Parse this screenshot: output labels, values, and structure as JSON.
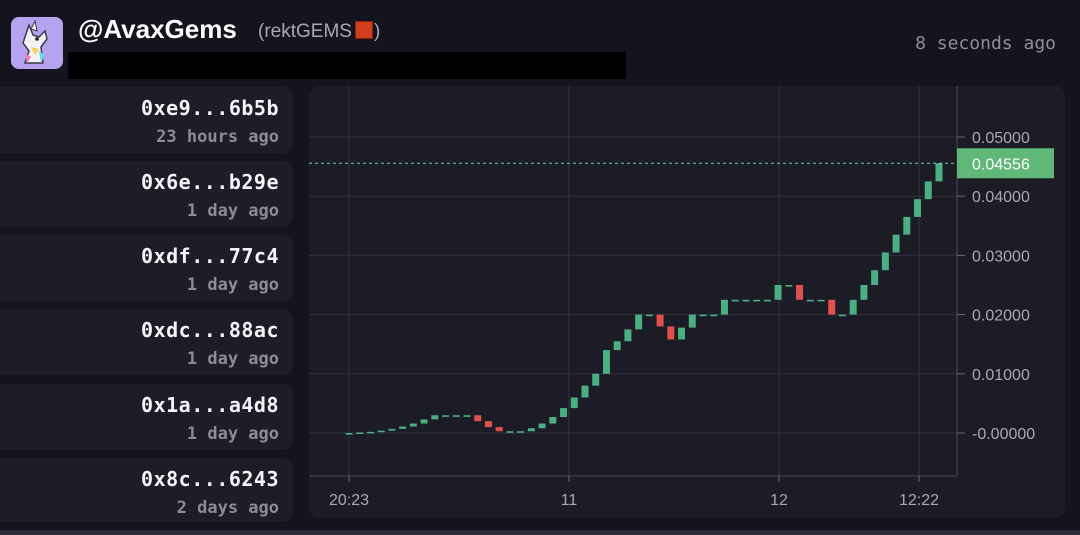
{
  "header": {
    "handle": "@AvaxGems",
    "subtitle": "(rektGEMS",
    "subtitle_close": ")",
    "updated": "8 seconds ago"
  },
  "wallets": [
    {
      "address": "0xe9...6b5b",
      "time": "23 hours ago"
    },
    {
      "address": "0x6e...b29e",
      "time": "1 day ago"
    },
    {
      "address": "0xdf...77c4",
      "time": "1 day ago"
    },
    {
      "address": "0xdc...88ac",
      "time": "1 day ago"
    },
    {
      "address": "0x1a...a4d8",
      "time": "1 day ago"
    },
    {
      "address": "0x8c...6243",
      "time": "2 days ago"
    }
  ],
  "colors": {
    "up": "#4caf82",
    "down": "#e0504c",
    "price_tag": "#5fb878",
    "grid": "#33333f"
  },
  "chart_data": {
    "type": "candlestick",
    "x_ticks": [
      "20:23",
      "11",
      "12",
      "12:22"
    ],
    "y_ticks": [
      "0.05000",
      "0.04000",
      "0.03000",
      "0.02000",
      "0.01000",
      "-0.00000"
    ],
    "ylim": [
      -0.005,
      0.058
    ],
    "last_price": "0.04556",
    "candles": [
      {
        "o": 0.0,
        "c": 0.0
      },
      {
        "o": 0.0,
        "c": 0.0001
      },
      {
        "o": 0.0001,
        "c": 0.0002
      },
      {
        "o": 0.0002,
        "c": 0.0004
      },
      {
        "o": 0.0004,
        "c": 0.0007
      },
      {
        "o": 0.0007,
        "c": 0.0011
      },
      {
        "o": 0.0011,
        "c": 0.0016
      },
      {
        "o": 0.0016,
        "c": 0.0023
      },
      {
        "o": 0.0023,
        "c": 0.003
      },
      {
        "o": 0.003,
        "c": 0.003
      },
      {
        "o": 0.003,
        "c": 0.003
      },
      {
        "o": 0.003,
        "c": 0.003
      },
      {
        "o": 0.003,
        "c": 0.002
      },
      {
        "o": 0.002,
        "c": 0.001
      },
      {
        "o": 0.001,
        "c": 0.0003
      },
      {
        "o": 0.0003,
        "c": 0.0003
      },
      {
        "o": 0.0003,
        "c": 0.0003
      },
      {
        "o": 0.0003,
        "c": 0.0008
      },
      {
        "o": 0.0008,
        "c": 0.0016
      },
      {
        "o": 0.0016,
        "c": 0.0027
      },
      {
        "o": 0.0027,
        "c": 0.0042
      },
      {
        "o": 0.0042,
        "c": 0.006
      },
      {
        "o": 0.006,
        "c": 0.008
      },
      {
        "o": 0.008,
        "c": 0.01
      },
      {
        "o": 0.01,
        "c": 0.014
      },
      {
        "o": 0.014,
        "c": 0.0155
      },
      {
        "o": 0.0155,
        "c": 0.0175
      },
      {
        "o": 0.0175,
        "c": 0.02
      },
      {
        "o": 0.02,
        "c": 0.02
      },
      {
        "o": 0.02,
        "c": 0.018
      },
      {
        "o": 0.018,
        "c": 0.0158
      },
      {
        "o": 0.0158,
        "c": 0.0178
      },
      {
        "o": 0.0178,
        "c": 0.02
      },
      {
        "o": 0.02,
        "c": 0.02
      },
      {
        "o": 0.02,
        "c": 0.02
      },
      {
        "o": 0.02,
        "c": 0.0225
      },
      {
        "o": 0.0225,
        "c": 0.0225
      },
      {
        "o": 0.0225,
        "c": 0.0225
      },
      {
        "o": 0.0225,
        "c": 0.0225
      },
      {
        "o": 0.0225,
        "c": 0.0225
      },
      {
        "o": 0.0225,
        "c": 0.025
      },
      {
        "o": 0.025,
        "c": 0.025
      },
      {
        "o": 0.025,
        "c": 0.0225
      },
      {
        "o": 0.0225,
        "c": 0.0225
      },
      {
        "o": 0.0225,
        "c": 0.0225
      },
      {
        "o": 0.0225,
        "c": 0.02
      },
      {
        "o": 0.02,
        "c": 0.02
      },
      {
        "o": 0.02,
        "c": 0.0225
      },
      {
        "o": 0.0225,
        "c": 0.025
      },
      {
        "o": 0.025,
        "c": 0.0275
      },
      {
        "o": 0.0275,
        "c": 0.0305
      },
      {
        "o": 0.0305,
        "c": 0.0335
      },
      {
        "o": 0.0335,
        "c": 0.0365
      },
      {
        "o": 0.0365,
        "c": 0.0395
      },
      {
        "o": 0.0395,
        "c": 0.0425
      },
      {
        "o": 0.0425,
        "c": 0.04556
      }
    ]
  }
}
